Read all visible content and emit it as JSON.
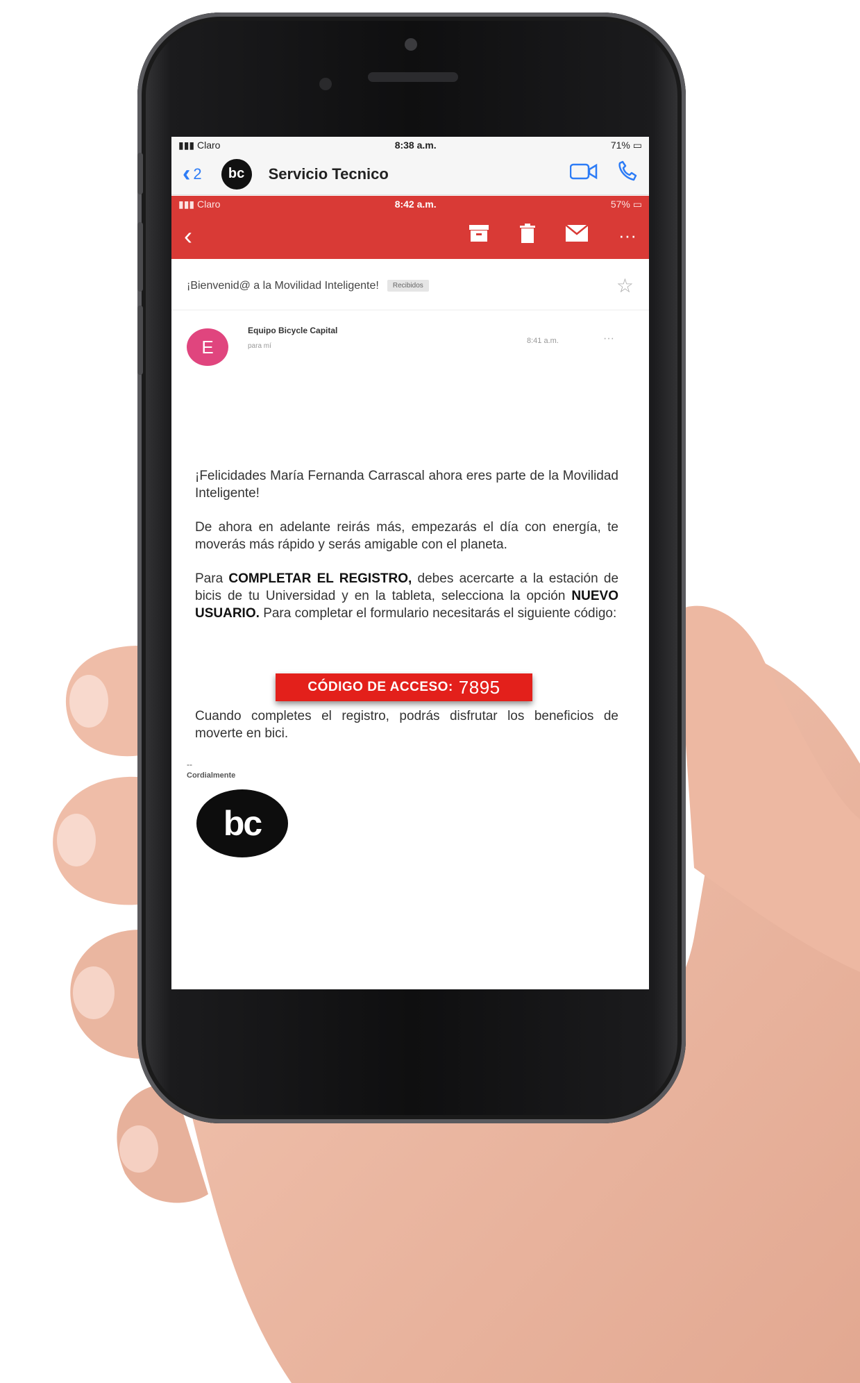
{
  "status_bar_top": {
    "carrier": "Claro",
    "time": "8:38 a.m.",
    "battery": "71%"
  },
  "messages_header": {
    "back_count": "2",
    "avatar_text": "bc",
    "contact_name": "Servicio Tecnico"
  },
  "status_bar_mail": {
    "carrier": "Claro",
    "time": "8:42 a.m.",
    "battery": "57%"
  },
  "email": {
    "subject": "¡Bienvenid@ a la Movilidad Inteligente!",
    "label": "Recibidos",
    "sender_initial": "E",
    "sender_name": "Equipo Bicycle Capital",
    "sender_to": "para mí",
    "sender_time": "8:41 a.m.",
    "para1": "¡Felicidades María Fernanda Carrascal ahora eres parte de la Movilidad Inteligente!",
    "para2": "De ahora en adelante reirás más, empezarás el día con energía, te moverás más rápido y serás amigable con el planeta.",
    "para3_a": "Para",
    "para3_b": "COMPLETAR EL REGISTRO,",
    "para3_c": "debes acercarte a la estación de bicis de tu Universidad y en la tableta, selecciona la opción",
    "para3_d": "NUEVO USUARIO.",
    "para3_e": "Para completar el formulario necesitarás el siguiente código:",
    "code_label": "CÓDIGO DE ACCESO:",
    "code_value": "7895",
    "para4": "Cuando completes el registro, podrás disfrutar los beneficios de moverte en bici.",
    "sig_dash": "--",
    "sig_label": "Cordialmente",
    "sig_logo": "bc"
  },
  "icons": [
    "back-chevron-icon",
    "video-call-icon",
    "phone-icon",
    "archive-icon",
    "trash-icon",
    "mail-icon",
    "more-icon",
    "star-icon"
  ],
  "colors": {
    "mail_bar": "#d93a36",
    "code_box": "#e3201b",
    "ios_blue": "#2d7cf6",
    "avatar_pink": "#e0457e"
  }
}
